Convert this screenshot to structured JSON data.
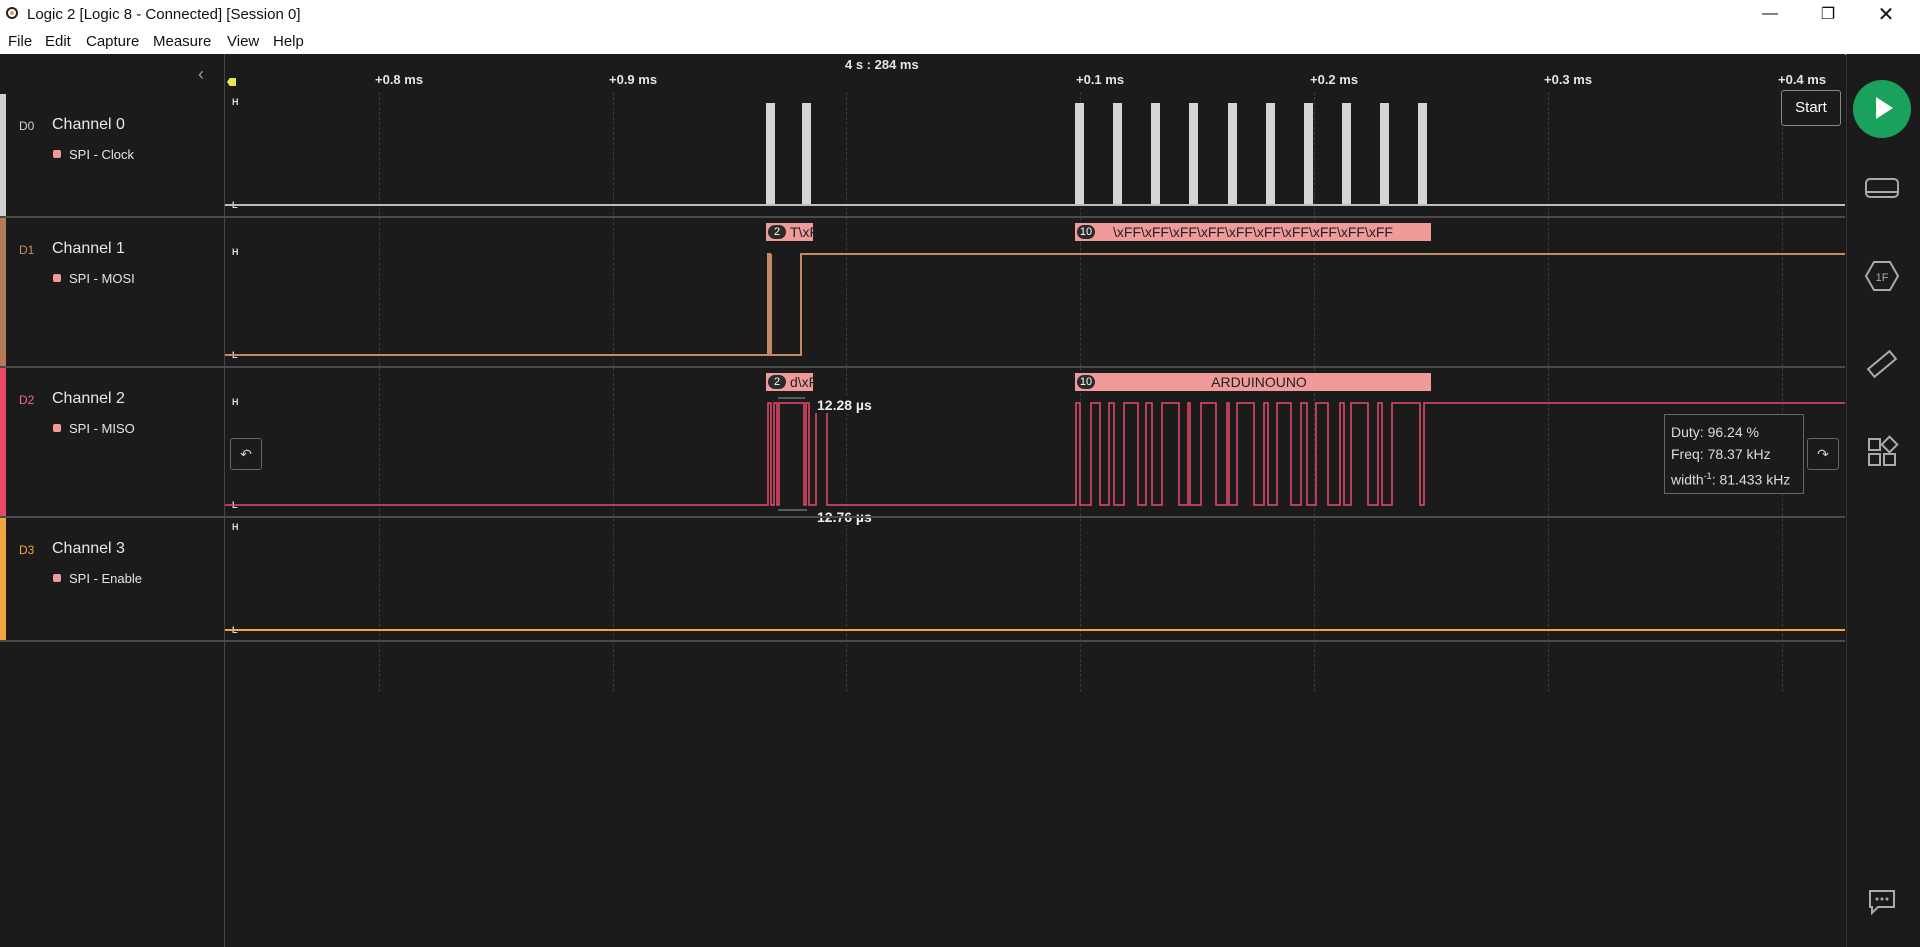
{
  "window": {
    "title": "Logic 2 [Logic 8 - Connected] [Session 0]"
  },
  "menu": {
    "items": [
      "File",
      "Edit",
      "Capture",
      "Measure",
      "View",
      "Help"
    ]
  },
  "ruler": {
    "center_timestamp": "4 s : 284 ms",
    "ticks": [
      "+0.8 ms",
      "+0.9 ms",
      "+0.1 ms",
      "+0.2 ms",
      "+0.3 ms",
      "+0.4 ms"
    ]
  },
  "level_labels": {
    "high": "H",
    "low": "L"
  },
  "channels": [
    {
      "id": "D0",
      "name": "Channel 0",
      "analyzer": "SPI - Clock",
      "color": "#d0d0d0"
    },
    {
      "id": "D1",
      "name": "Channel 1",
      "analyzer": "SPI - MOSI",
      "color": "#b37a5a"
    },
    {
      "id": "D2",
      "name": "Channel 2",
      "analyzer": "SPI - MISO",
      "color": "#e94a6a"
    },
    {
      "id": "D3",
      "name": "Channel 3",
      "analyzer": "SPI - Enable",
      "color": "#f2a640"
    }
  ],
  "packets": {
    "mosi_1": {
      "count": "2",
      "text": "T\\xF"
    },
    "mosi_2": {
      "count": "10",
      "text": "\\xFF\\xFF\\xFF\\xFF\\xFF\\xFF\\xFF\\xFF\\xFF\\xFF"
    },
    "miso_1": {
      "count": "2",
      "text": "d\\xF"
    },
    "miso_2": {
      "count": "10",
      "text": "ARDUINOUNO"
    }
  },
  "measurements": {
    "upper": "12.28 µs",
    "lower": "12.76 µs"
  },
  "tooltip": {
    "duty": "Duty: 96.24 %",
    "freq": "Freq: 78.37 kHz",
    "width_prefix": "width",
    "width_exp": "-1",
    "width_value": ": 81.433 kHz"
  },
  "start": {
    "label": "Start"
  },
  "right_sidebar": {
    "icons": [
      "device-icon",
      "analyzers-icon",
      "measure-icon",
      "extensions-icon",
      "feedback-icon"
    ]
  }
}
